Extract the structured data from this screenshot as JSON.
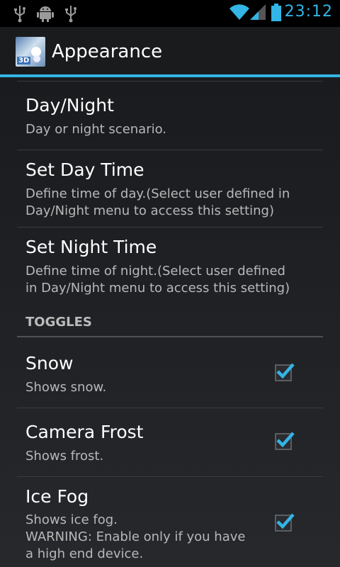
{
  "statusbar": {
    "time": "23:12",
    "icons": [
      "usb-icon",
      "android-debug-icon",
      "usb-icon",
      "wifi-icon",
      "signal-icon",
      "battery-icon"
    ]
  },
  "actionbar": {
    "title": "Appearance",
    "app_icon_label": "3D"
  },
  "preferences": [
    {
      "title": "Day/Night",
      "summary": "Day or night scenario."
    },
    {
      "title": "Set Day Time",
      "summary_lines": [
        "Define time of day.(Select user defined in",
        "Day/Night menu to access this setting)"
      ]
    },
    {
      "title": "Set Night Time",
      "summary_lines": [
        "Define time of night.(Select user defined",
        "in Day/Night menu to access this setting)"
      ]
    }
  ],
  "toggles": {
    "header": "TOGGLES",
    "items": [
      {
        "title": "Snow",
        "summary": "Shows snow.",
        "checked": true
      },
      {
        "title": "Camera Frost",
        "summary": "Shows frost.",
        "checked": true
      },
      {
        "title": "Ice Fog",
        "summary_lines": [
          "Shows ice fog.",
          "WARNING: Enable only if you have",
          "a high end device."
        ],
        "checked": true
      }
    ]
  },
  "colors": {
    "accent": "#33b5e5",
    "background": "#1c1d20",
    "summary_text": "#b8b8b8"
  }
}
